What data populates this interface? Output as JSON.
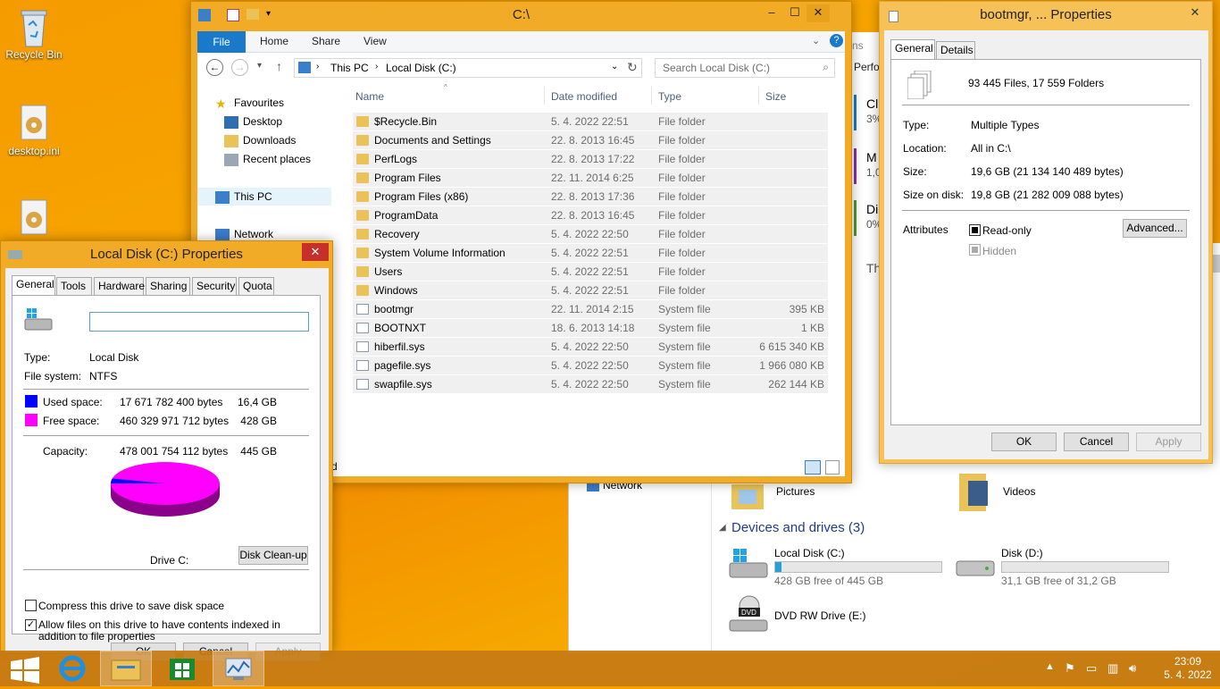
{
  "desktop": {
    "icons": [
      {
        "label": "Recycle Bin"
      },
      {
        "label": "desktop.ini"
      }
    ]
  },
  "explorer": {
    "title": "C:\\",
    "ribbon_tabs": [
      "File",
      "Home",
      "Share",
      "View"
    ],
    "address": [
      "This PC",
      "Local Disk (C:)"
    ],
    "search_placeholder": "Search Local Disk (C:)",
    "nav": {
      "favourites": "Favourites",
      "desktop": "Desktop",
      "downloads": "Downloads",
      "recent": "Recent places",
      "this_pc": "This PC",
      "network": "Network"
    },
    "columns": {
      "name": "Name",
      "date": "Date modified",
      "type": "Type",
      "size": "Size"
    },
    "files": [
      {
        "name": "$Recycle.Bin",
        "date": "5. 4. 2022 22:51",
        "type": "File folder",
        "size": "",
        "kind": "folder"
      },
      {
        "name": "Documents and Settings",
        "date": "22. 8. 2013 16:45",
        "type": "File folder",
        "size": "",
        "kind": "link"
      },
      {
        "name": "PerfLogs",
        "date": "22. 8. 2013 17:22",
        "type": "File folder",
        "size": "",
        "kind": "folder"
      },
      {
        "name": "Program Files",
        "date": "22. 11. 2014 6:25",
        "type": "File folder",
        "size": "",
        "kind": "folder"
      },
      {
        "name": "Program Files (x86)",
        "date": "22. 8. 2013 17:36",
        "type": "File folder",
        "size": "",
        "kind": "folder"
      },
      {
        "name": "ProgramData",
        "date": "22. 8. 2013 16:45",
        "type": "File folder",
        "size": "",
        "kind": "folder"
      },
      {
        "name": "Recovery",
        "date": "5. 4. 2022 22:50",
        "type": "File folder",
        "size": "",
        "kind": "folder"
      },
      {
        "name": "System Volume Information",
        "date": "5. 4. 2022 22:51",
        "type": "File folder",
        "size": "",
        "kind": "folder"
      },
      {
        "name": "Users",
        "date": "5. 4. 2022 22:51",
        "type": "File folder",
        "size": "",
        "kind": "folder"
      },
      {
        "name": "Windows",
        "date": "5. 4. 2022 22:51",
        "type": "File folder",
        "size": "",
        "kind": "folder"
      },
      {
        "name": "bootmgr",
        "date": "22. 11. 2014 2:15",
        "type": "System file",
        "size": "395 KB",
        "kind": "system"
      },
      {
        "name": "BOOTNXT",
        "date": "18. 6. 2013 14:18",
        "type": "System file",
        "size": "1 KB",
        "kind": "system"
      },
      {
        "name": "hiberfil.sys",
        "date": "5. 4. 2022 22:50",
        "type": "System file",
        "size": "6 615 340 KB",
        "kind": "system"
      },
      {
        "name": "pagefile.sys",
        "date": "5. 4. 2022 22:50",
        "type": "System file",
        "size": "1 966 080 KB",
        "kind": "system"
      },
      {
        "name": "swapfile.sys",
        "date": "5. 4. 2022 22:50",
        "type": "System file",
        "size": "262 144 KB",
        "kind": "system"
      }
    ],
    "status_fragment": "ted"
  },
  "bg_explorer": {
    "network": "Network",
    "pictures": "Pictures",
    "videos": "Videos",
    "devices_header": "Devices and drives (3)",
    "drives": [
      {
        "name": "Local Disk (C:)",
        "free": "428 GB free of 445 GB",
        "used_fraction": 0.04
      },
      {
        "name": "Disk (D:)",
        "free": "31,1 GB free of 31,2 GB",
        "used_fraction": 0.0
      },
      {
        "name": "DVD RW Drive (E:)",
        "free": "",
        "used_fraction": null
      }
    ],
    "strip_texts": [
      "ns",
      "Perfo",
      "Cl",
      "3%",
      "M",
      "1,0",
      "Di",
      "0%",
      "Th"
    ]
  },
  "disk_props": {
    "title": "Local Disk (C:) Properties",
    "tabs": [
      "General",
      "Tools",
      "Hardware",
      "Sharing",
      "Security",
      "Quota"
    ],
    "label_value": "",
    "type_label": "Type:",
    "type_value": "Local Disk",
    "fs_label": "File system:",
    "fs_value": "NTFS",
    "used_label": "Used space:",
    "used_bytes": "17 671 782 400 bytes",
    "used_gb": "16,4 GB",
    "free_label": "Free space:",
    "free_bytes": "460 329 971 712 bytes",
    "free_gb": "428 GB",
    "cap_label": "Capacity:",
    "cap_bytes": "478 001 754 112 bytes",
    "cap_gb": "445 GB",
    "drive_label": "Drive C:",
    "cleanup": "Disk Clean-up",
    "compress": "Compress this drive to save disk space",
    "index": "Allow files on this drive to have contents indexed in addition to file properties",
    "ok": "OK",
    "cancel": "Cancel",
    "apply": "Apply",
    "colors": {
      "used": "#0000ff",
      "free": "#ff00ff"
    },
    "used_fraction": 0.037
  },
  "boot_props": {
    "title": "bootmgr, ... Properties",
    "tabs": [
      "General",
      "Details"
    ],
    "summary": "93 445 Files, 17 559 Folders",
    "type_label": "Type:",
    "type_value": "Multiple Types",
    "loc_label": "Location:",
    "loc_value": "All in C:\\",
    "size_label": "Size:",
    "size_value": "19,6 GB (21 134 140 489 bytes)",
    "sod_label": "Size on disk:",
    "sod_value": "19,8 GB (21 282 009 088 bytes)",
    "attr_label": "Attributes",
    "readonly": "Read-only",
    "hidden": "Hidden",
    "advanced": "Advanced...",
    "ok": "OK",
    "cancel": "Cancel",
    "apply": "Apply"
  },
  "taskbar": {
    "time": "23:09",
    "date": "5. 4. 2022"
  }
}
